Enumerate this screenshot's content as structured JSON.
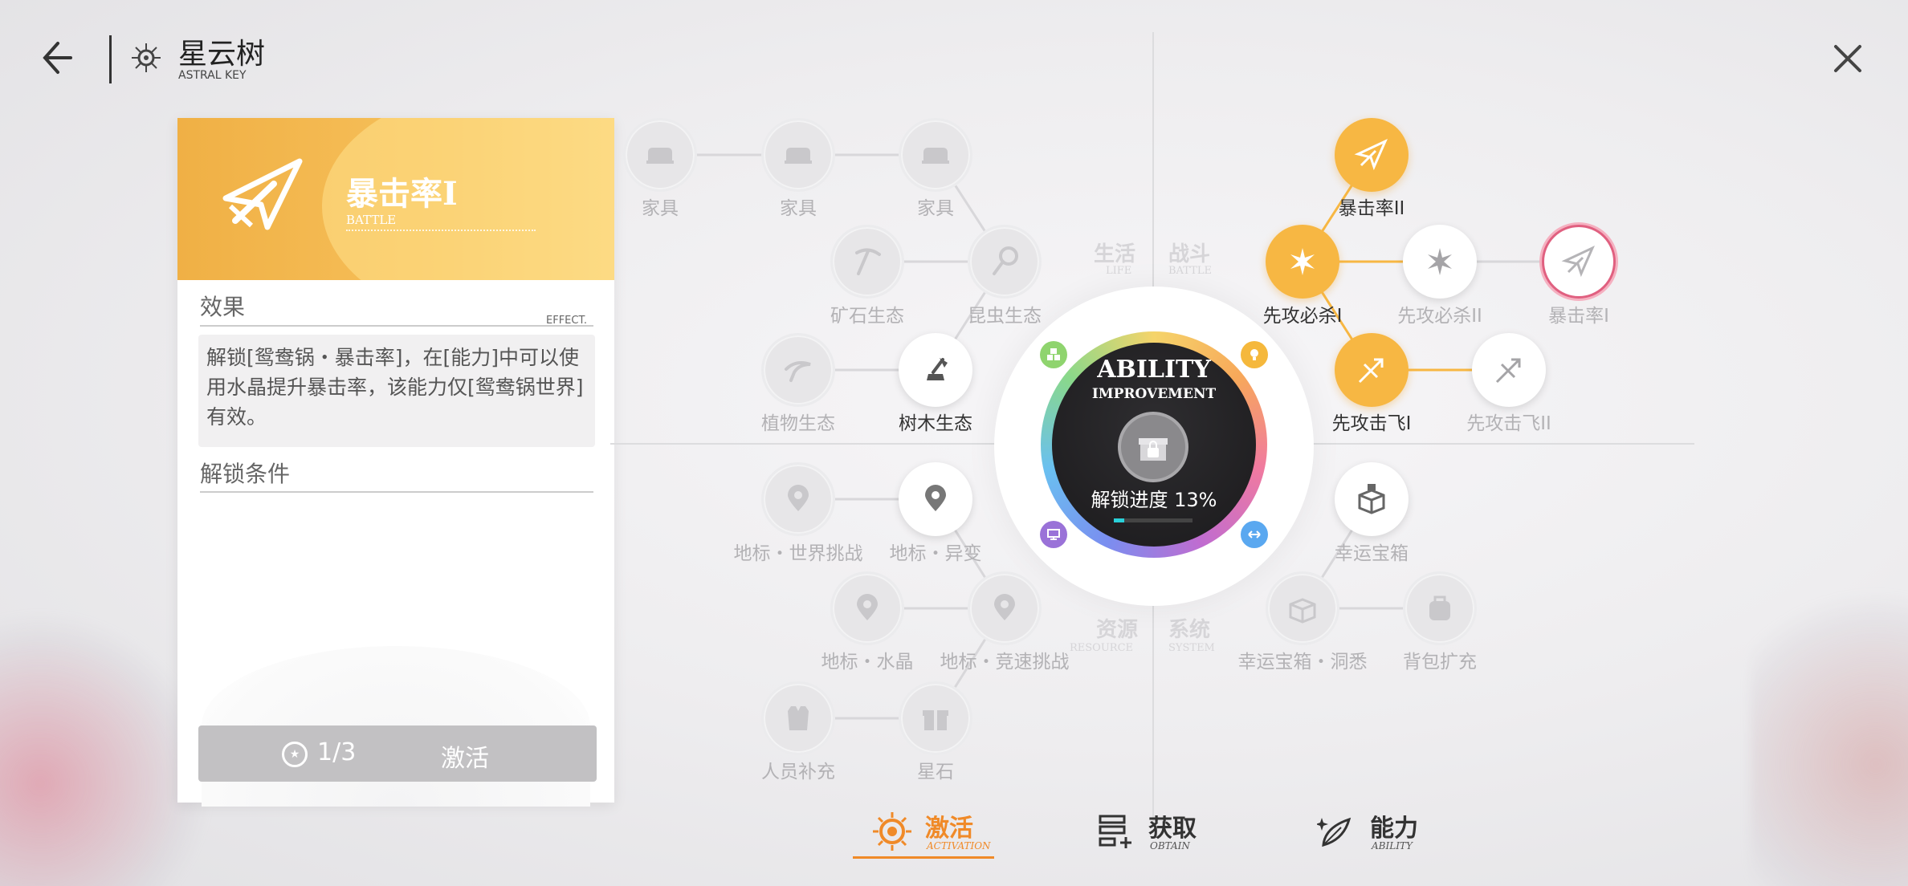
{
  "header": {
    "title": "星云树",
    "subtitle": "ASTRAL KEY"
  },
  "detail": {
    "name": "暴击率I",
    "category": "BATTLE",
    "effect_label": "效果",
    "effect_label_en": "EFFECT.",
    "effect_text": "解锁[鸳鸯锅・暴击率]，在[能力]中可以使用水晶提升暴击率，该能力仅[鸳鸯锅世界]有效。",
    "unlock_label": "解锁条件",
    "cost": "1/3",
    "activate_label": "激活"
  },
  "quadrants": {
    "life": "生活",
    "life_en": "LIFE",
    "battle": "战斗",
    "battle_en": "BATTLE",
    "resource": "资源",
    "resource_en": "RESOURCE",
    "system": "系统",
    "system_en": "SYSTEM"
  },
  "hub": {
    "title": "ABILITY",
    "subtitle": "IMPROVEMENT",
    "progress_text": "解锁进度 13%",
    "progress": 0.13
  },
  "nodes": {
    "furniture1": "家具",
    "furniture2": "家具",
    "furniture3": "家具",
    "ore": "矿石生态",
    "insect": "昆虫生态",
    "plant": "植物生态",
    "tree": "树木生态",
    "crit2": "暴击率II",
    "first_kill1": "先攻必杀I",
    "first_kill2": "先攻必杀II",
    "crit1": "暴击率I",
    "first_fly1": "先攻击飞I",
    "first_fly2": "先攻击飞II",
    "landmark_world": "地标・世界挑战",
    "landmark_anomaly": "地标・异变",
    "landmark_crystal": "地标・水晶",
    "landmark_race": "地标・竞速挑战",
    "staff": "人员补充",
    "starstone": "星石",
    "lucky_box": "幸运宝箱",
    "lucky_box_insight": "幸运宝箱・洞悉",
    "bag": "背包扩充"
  },
  "tabs": {
    "activate": "激活",
    "activate_en": "ACTIVATION",
    "obtain": "获取",
    "obtain_en": "OBTAIN",
    "ability": "能力",
    "ability_en": "ABILITY"
  },
  "colors": {
    "accent": "#f7b743",
    "active_tab": "#f08a28",
    "selected_ring": "#e06080"
  }
}
